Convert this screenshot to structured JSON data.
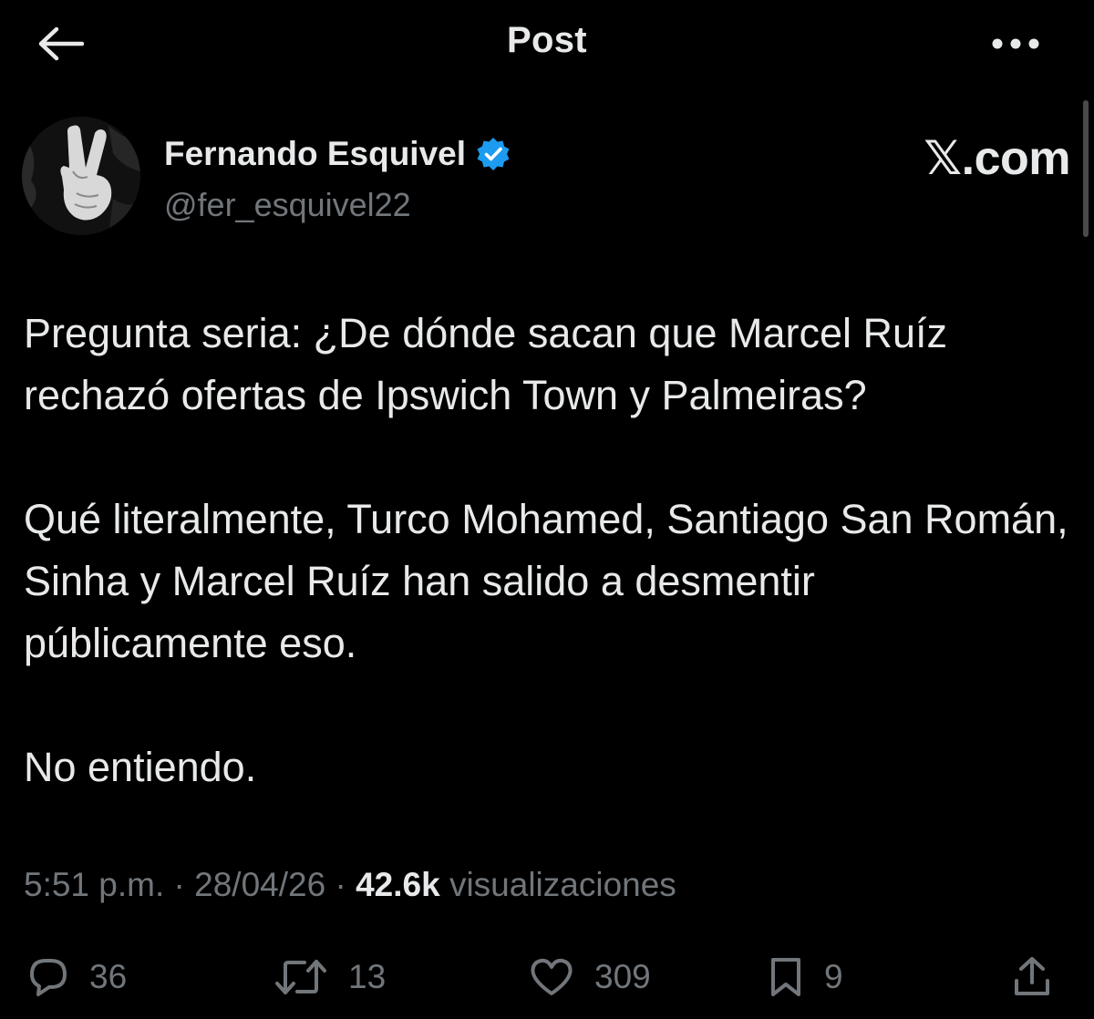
{
  "header": {
    "title": "Post"
  },
  "author": {
    "display_name": "Fernando Esquivel",
    "handle": "@fer_esquivel22",
    "verified": true
  },
  "watermark": "𝕏.com",
  "post": {
    "paragraphs": [
      "Pregunta seria: ¿De dónde sacan que Marcel Ruíz rechazó ofertas de Ipswich Town y Palmeiras?",
      "Qué literalmente, Turco Mohamed, Santiago San Román, Sinha y Marcel Ruíz han salido a desmentir públicamente eso.",
      "No entiendo."
    ]
  },
  "meta": {
    "time": "5:51 p.m.",
    "separator": "·",
    "date": "28/04/26",
    "views_count": "42.6k",
    "views_label": "visualizaciones"
  },
  "actions": {
    "replies": "36",
    "reposts": "13",
    "likes": "309",
    "bookmarks": "9"
  },
  "colors": {
    "background": "#000000",
    "text": "#e7e9ea",
    "secondary": "#71767b",
    "verified_badge": "#1d9bf0"
  },
  "icons": {
    "back": "arrow-left-icon",
    "more": "ellipsis-icon",
    "verified": "verified-badge-icon",
    "reply": "comment-bubble-icon",
    "repost": "repost-arrows-icon",
    "like": "heart-icon",
    "bookmark": "bookmark-icon",
    "share": "share-upload-icon"
  }
}
